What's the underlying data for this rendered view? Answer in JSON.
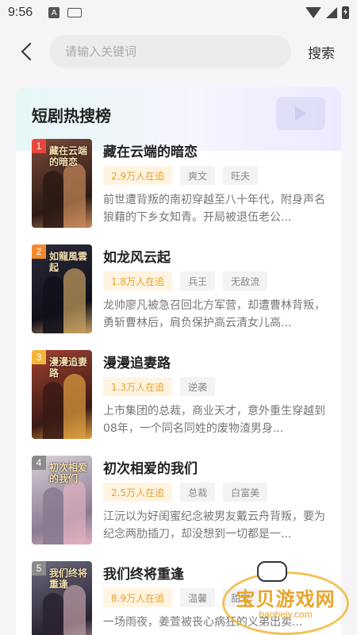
{
  "status_bar": {
    "time": "9:56",
    "app_badge": "A"
  },
  "search": {
    "placeholder": "请输入关键词",
    "button_label": "搜索"
  },
  "card": {
    "title": "短剧热搜榜"
  },
  "items": [
    {
      "rank": "1",
      "title": "藏在云端的暗恋",
      "heat": "2.9万人在追",
      "tags": [
        "爽文",
        "旺夫"
      ],
      "desc": "前世遭背叛的南初穿越至八十年代，附身声名狼藉的下乡女知青。开局被退伍老公...",
      "poster_text": "藏在云端的暗恋",
      "rank_color": "#e8463c"
    },
    {
      "rank": "2",
      "title": "如龙风云起",
      "heat": "1.8万人在追",
      "tags": [
        "兵王",
        "无敌流"
      ],
      "desc": "龙帅廖凡被急召回北方军营，却遭曹林背叛，勇斩曹林后，肩负保护高云清女儿高...",
      "poster_text": "如龍風雲起",
      "rank_color": "#f18a2b"
    },
    {
      "rank": "3",
      "title": "漫漫追妻路",
      "heat": "1.3万人在追",
      "tags": [
        "逆袭"
      ],
      "desc": "上市集团的总裁，商业天才，意外重生穿越到08年，一个同名同姓的废物渣男身...",
      "poster_text": "漫漫追妻路",
      "rank_color": "#f3b63a"
    },
    {
      "rank": "4",
      "title": "初次相爱的我们",
      "heat": "2.5万人在追",
      "tags": [
        "总裁",
        "白富美"
      ],
      "desc": "江沅以为好闺蜜纪念被男友戴云舟背叛，要为纪念两肋插刀，却没想到一切都是一...",
      "poster_text": "初次相爱的我们",
      "rank_color": "#8c8c8c"
    },
    {
      "rank": "5",
      "title": "我们终将重逢",
      "heat": "8.9万人在追",
      "tags": [
        "温馨",
        "甜宠"
      ],
      "desc": "一场雨夜，姜萱被丧心病狂的义弟出卖...",
      "poster_text": "我们终将重逢",
      "rank_color": "#8c8c8c"
    }
  ],
  "watermark": {
    "text": "宝贝游戏网",
    "url": "baobeiy.com"
  }
}
